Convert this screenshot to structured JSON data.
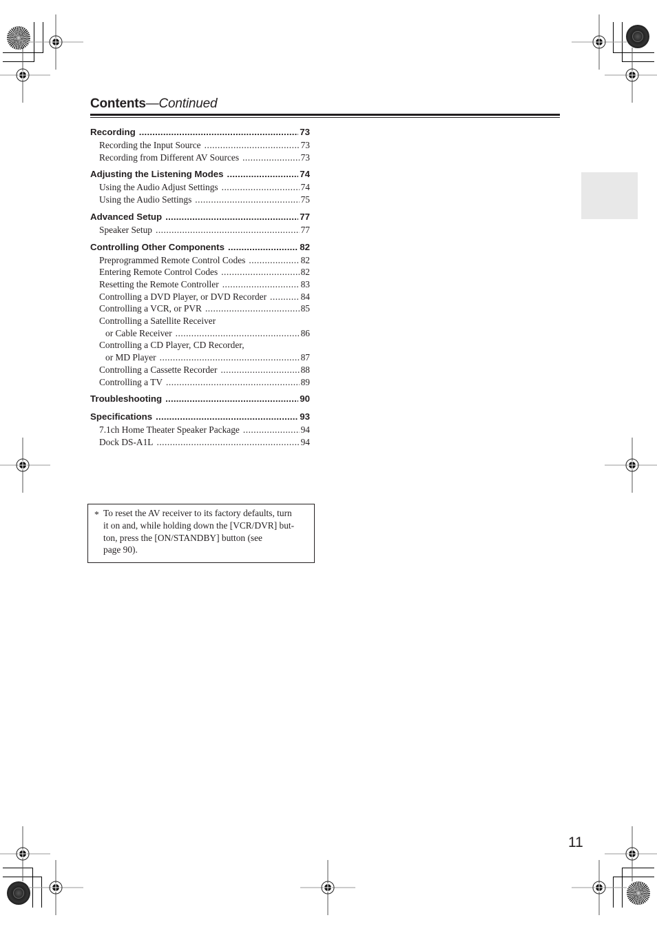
{
  "header": {
    "title_bold": "Contents",
    "title_italic": "—Continued"
  },
  "toc": [
    {
      "title": "Recording",
      "page": "73",
      "items": [
        {
          "label": "Recording the Input Source",
          "page": "73"
        },
        {
          "label": "Recording from Different AV Sources",
          "page": "73"
        }
      ]
    },
    {
      "title": "Adjusting the Listening Modes",
      "page": "74",
      "items": [
        {
          "label": "Using the Audio Adjust Settings",
          "page": "74"
        },
        {
          "label": "Using the Audio Settings",
          "page": "75"
        }
      ]
    },
    {
      "title": "Advanced Setup",
      "page": "77",
      "items": [
        {
          "label": "Speaker Setup",
          "page": "77"
        }
      ]
    },
    {
      "title": "Controlling Other Components",
      "page": "82",
      "items": [
        {
          "label": "Preprogrammed Remote Control Codes",
          "page": "82"
        },
        {
          "label": "Entering Remote Control Codes",
          "page": "82"
        },
        {
          "label": "Resetting the Remote Controller",
          "page": "83"
        },
        {
          "label": "Controlling a DVD Player, or DVD Recorder",
          "page": "84"
        },
        {
          "label": "Controlling a VCR, or PVR",
          "page": "85"
        },
        {
          "label": "Controlling a Satellite Receiver",
          "cont": "or Cable Receiver",
          "page": "86"
        },
        {
          "label": "Controlling a CD Player, CD Recorder,",
          "cont": "or MD Player",
          "page": "87"
        },
        {
          "label": "Controlling a Cassette Recorder",
          "page": "88"
        },
        {
          "label": "Controlling a TV",
          "page": "89"
        }
      ]
    },
    {
      "title": "Troubleshooting",
      "page": "90",
      "items": []
    },
    {
      "title": "Specifications",
      "page": "93",
      "items": [
        {
          "label": "7.1ch Home Theater Speaker Package",
          "page": "94"
        },
        {
          "label": "Dock DS-A1L",
          "page": "94"
        }
      ]
    }
  ],
  "note": {
    "marker": "*",
    "text": "To reset the AV receiver to its factory defaults, turn it on and, while holding down the [VCR/DVR] button, press the [ON/STANDBY] button (see page 90).",
    "lines": [
      "To reset the AV receiver to its factory defaults, turn",
      "it on and, while holding down the [VCR/DVR] but-",
      "ton, press the [ON/STANDBY] button (see",
      "page 90)."
    ]
  },
  "page_number": "11",
  "icons": {
    "registration_mark": "crosshair-target-icon",
    "color_disc_rays": "starburst-disc-icon",
    "color_disc_dark": "dark-disc-icon"
  }
}
